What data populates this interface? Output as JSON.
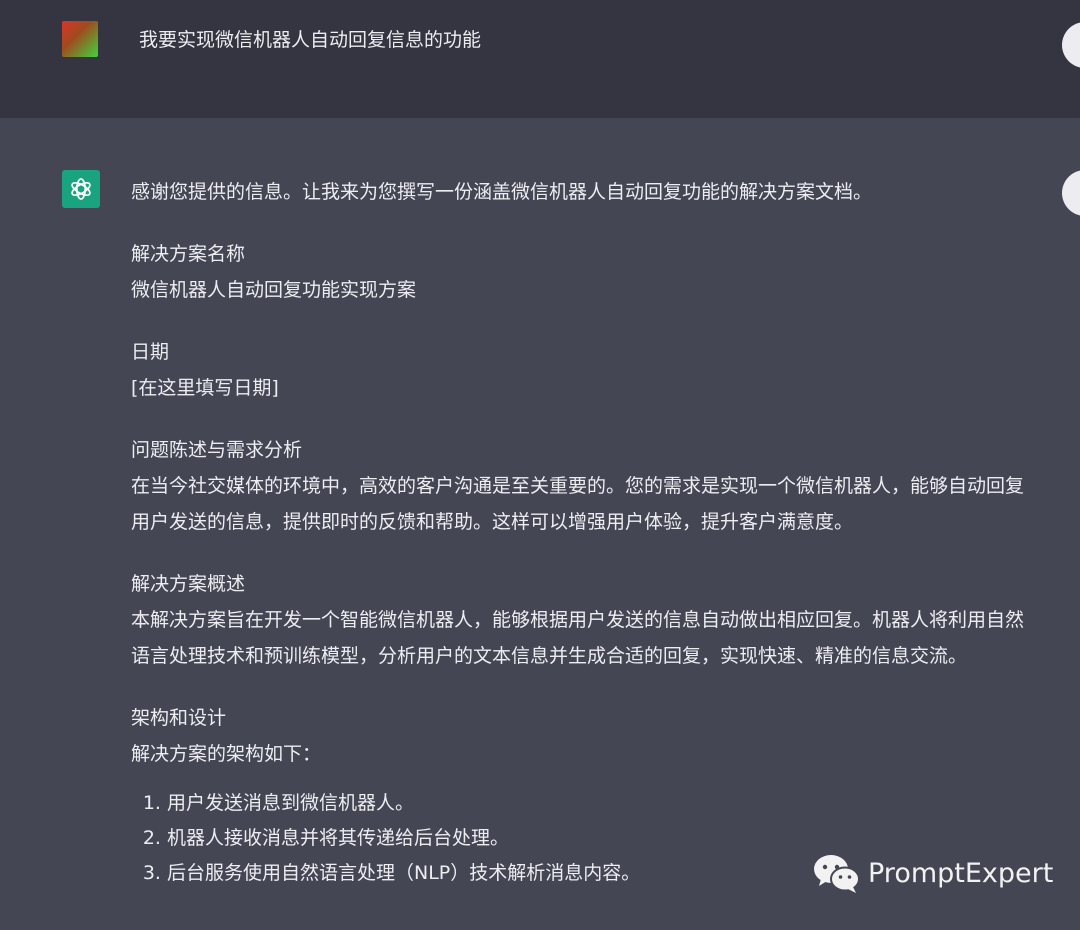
{
  "user_message": "我要实现微信机器人自动回复信息的功能",
  "assistant": {
    "intro": "感谢您提供的信息。让我来为您撰写一份涵盖微信机器人自动回复功能的解决方案文档。",
    "sections": [
      {
        "heading": "解决方案名称",
        "body": "微信机器人自动回复功能实现方案"
      },
      {
        "heading": "日期",
        "body": "[在这里填写日期]"
      },
      {
        "heading": "问题陈述与需求分析",
        "body": "在当今社交媒体的环境中，高效的客户沟通是至关重要的。您的需求是实现一个微信机器人，能够自动回复用户发送的信息，提供即时的反馈和帮助。这样可以增强用户体验，提升客户满意度。"
      },
      {
        "heading": "解决方案概述",
        "body": "本解决方案旨在开发一个智能微信机器人，能够根据用户发送的信息自动做出相应回复。机器人将利用自然语言处理技术和预训练模型，分析用户的文本信息并生成合适的回复，实现快速、精准的信息交流。"
      },
      {
        "heading": "架构和设计",
        "body": "解决方案的架构如下："
      }
    ],
    "list_items": [
      "用户发送消息到微信机器人。",
      "机器人接收消息并将其传递给后台处理。",
      "后台服务使用自然语言处理（NLP）技术解析消息内容。"
    ]
  },
  "watermark": "PromptExpert",
  "icons": {
    "user_avatar": "user-avatar",
    "assistant_avatar": "chatgpt-logo-icon",
    "watermark_icon": "wechat-icon"
  },
  "colors": {
    "user_bg": "#343541",
    "assistant_bg": "#444654",
    "assistant_avatar_bg": "#19a37f",
    "text": "#ececf1"
  }
}
